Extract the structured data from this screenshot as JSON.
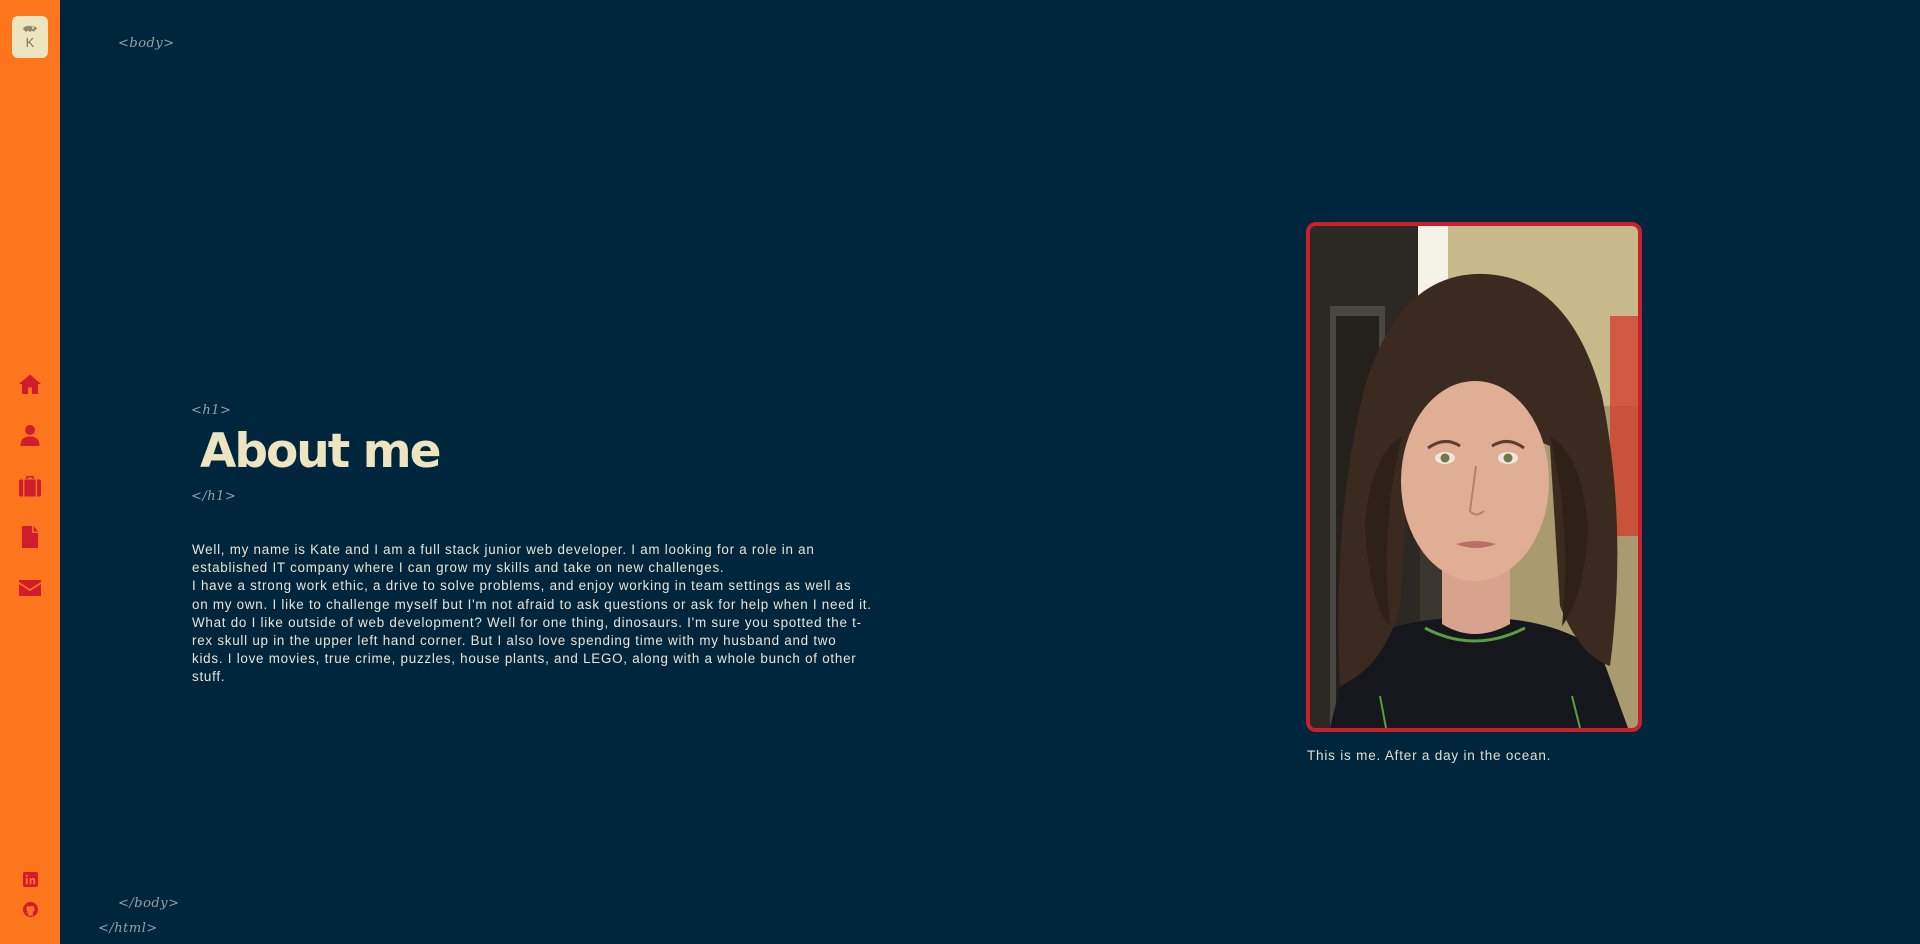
{
  "sidebar": {
    "logo": {
      "letter": "K",
      "skull_icon": "t-rex-skull-icon"
    },
    "nav": [
      {
        "name": "home",
        "icon": "home-icon"
      },
      {
        "name": "about",
        "icon": "user-icon"
      },
      {
        "name": "portfolio",
        "icon": "briefcase-icon"
      },
      {
        "name": "resume",
        "icon": "document-icon"
      },
      {
        "name": "contact",
        "icon": "envelope-icon"
      }
    ],
    "social": [
      {
        "name": "linkedin",
        "icon": "linkedin-icon"
      },
      {
        "name": "github",
        "icon": "github-icon"
      }
    ],
    "colors": {
      "background": "#fd761e",
      "icon": "#cf1d2e",
      "logo_bg": "#ede5c0"
    }
  },
  "tags": {
    "body_open": "<body>",
    "h1_open": "<h1>",
    "h1_close": "</h1>",
    "body_close": "</body>",
    "html_close": "</html>"
  },
  "main": {
    "title": "About me",
    "paragraphs": [
      "Well, my name is Kate and I am a full stack junior web developer. I am looking for a role in an established IT company where I can grow my skills and take on new challenges.",
      "I have a strong work ethic, a drive to solve problems, and enjoy working in team settings as well as on my own. I like to challenge myself but I'm not afraid to ask questions or ask for help when I need it.",
      "What do I like outside of web development? Well for one thing, dinosaurs. I'm sure you spotted the t-rex skull up in the upper left hand corner. But I also love spending time with my husband and two kids. I love movies, true crime, puzzles, house plants, and LEGO, along with a whole bunch of other stuff."
    ],
    "photo_caption": "This is me. After a day in the ocean.",
    "colors": {
      "background": "#00263d",
      "title": "#ede5c0",
      "photo_border": "#c9202c"
    }
  }
}
